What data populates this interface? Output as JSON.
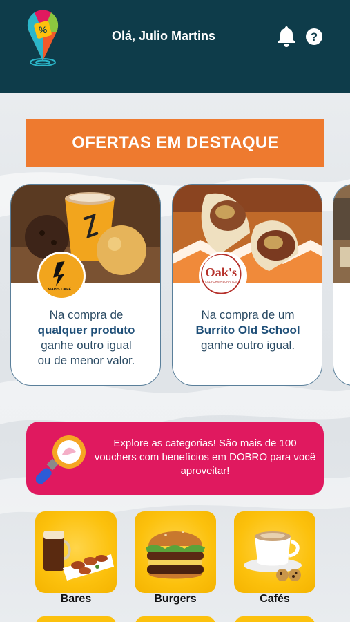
{
  "header": {
    "greeting": "Olá, Julio Martins",
    "logo_icon": "location-pin-percent-logo",
    "notifications_icon": "bell-icon",
    "help_icon": "help-circle-icon"
  },
  "featured": {
    "title": "OFERTAS EM DESTAQUE",
    "cards": [
      {
        "brand": "MAISS CAFÉ",
        "text_before": "Na compra de",
        "highlight": "qualquer produto",
        "text_after_1": "ganhe outro igual",
        "text_after_2": "ou de menor valor."
      },
      {
        "brand": "Oak's",
        "brand_sub": "CALIFORNIA BURRITOS",
        "text_before": "Na compra de um",
        "highlight": "Burrito Old School",
        "text_after_1": "ganhe outro igual.",
        "text_after_2": ""
      }
    ]
  },
  "promo": {
    "text": "Explore as categorias! São mais de 100 vouchers com benefícios em DOBRO para você aproveitar!",
    "icon": "magnifier-icon"
  },
  "categories": [
    {
      "label": "Bares",
      "icon": "beer-and-wings-icon"
    },
    {
      "label": "Burgers",
      "icon": "burger-icon"
    },
    {
      "label": "Cafés",
      "icon": "coffee-cup-icon"
    }
  ],
  "colors": {
    "header_bg": "#0e3c4a",
    "banner_bg": "#ee7a2f",
    "promo_bg": "#e0195f",
    "category_bg": "#fcc10d",
    "card_text": "#1f4f78"
  }
}
